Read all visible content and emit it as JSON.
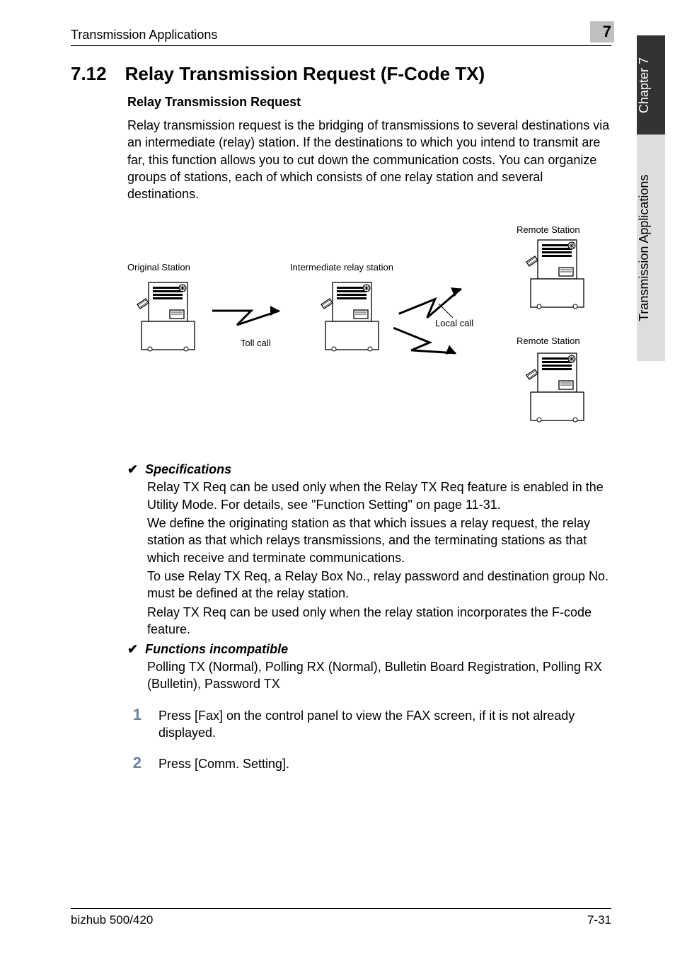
{
  "header": {
    "title": "Transmission Applications",
    "chapter_badge": "7"
  },
  "side_tabs": {
    "dark": "Chapter 7",
    "light": "Transmission Applications"
  },
  "section": {
    "number": "7.12",
    "title": "Relay Transmission Request (F-Code TX)"
  },
  "subhead": "Relay Transmission Request",
  "intro": "Relay transmission request is the bridging of transmissions to several destinations via an intermediate (relay) station. If the destinations to which you intend to transmit are far, this function allows you to cut down the communication costs. You can organize groups of stations, each of which consists of one relay station and several destinations.",
  "diagram": {
    "original_station": "Original Station",
    "intermediate": "Intermediate relay station",
    "remote_station_top": "Remote Station",
    "remote_station_bottom": "Remote Station",
    "toll_call": "Toll call",
    "local_call": "Local call"
  },
  "specs": {
    "check": "✔",
    "spec_label": "Specifications",
    "spec_p1": "Relay TX Req can be used only when the Relay TX Req feature is enabled in the Utility Mode. For details, see \"Function Setting\" on page 11-31.",
    "spec_p2": "We define the originating station as that which issues a relay request, the relay station as that which relays transmissions, and the terminating stations as that which receive and terminate communications.",
    "spec_p3": "To use Relay TX Req, a Relay Box No., relay password and destination group No. must be defined at the relay station.",
    "spec_p4": "Relay TX Req can be used only when the relay station incorporates the F-code feature.",
    "func_label": "Functions incompatible",
    "func_p": "Polling TX (Normal), Polling RX (Normal), Bulletin Board Registration, Polling RX (Bulletin), Password TX"
  },
  "steps": {
    "s1_num": "1",
    "s1": "Press [Fax] on the control panel to view the FAX screen, if it is not already displayed.",
    "s2_num": "2",
    "s2": "Press [Comm. Setting]."
  },
  "footer": {
    "left": "bizhub 500/420",
    "right": "7-31"
  }
}
